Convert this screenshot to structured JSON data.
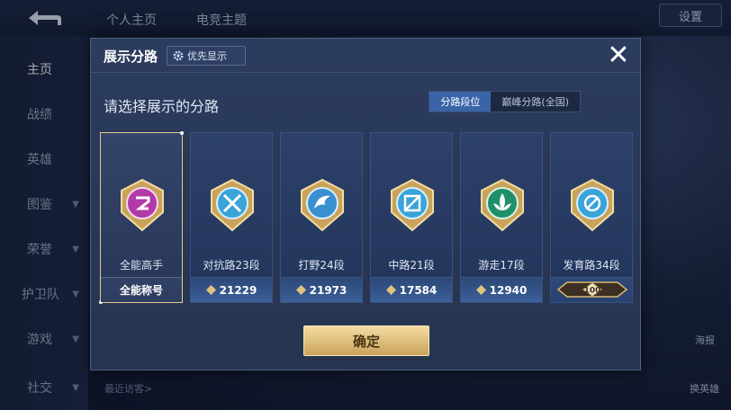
{
  "topbar": {
    "tabs": [
      "个人主页",
      "电竞主题"
    ],
    "settings_label": "设置"
  },
  "sidebar": {
    "items": [
      {
        "label": "主页",
        "active": true,
        "chevron": false
      },
      {
        "label": "战绩",
        "active": false,
        "chevron": false
      },
      {
        "label": "英雄",
        "active": false,
        "chevron": false
      },
      {
        "label": "图鉴",
        "active": false,
        "chevron": true
      },
      {
        "label": "荣誉",
        "active": false,
        "chevron": true
      },
      {
        "label": "护卫队",
        "active": false,
        "chevron": true
      },
      {
        "label": "游戏",
        "active": false,
        "chevron": true
      },
      {
        "label": "社交",
        "active": false,
        "chevron": true
      }
    ]
  },
  "bottom": {
    "recent_visitors": "最近访客>"
  },
  "right_panel": {
    "label_1": "海报",
    "label_2": "换英雄"
  },
  "dialog": {
    "title": "展示分路",
    "priority_label": "优先显示",
    "close_symbol": "✕",
    "prompt": "请选择展示的分路",
    "segments": [
      {
        "label": "分路段位",
        "active": true
      },
      {
        "label": "巅峰分路(全国)",
        "active": false
      }
    ],
    "cards": [
      {
        "label": "全能高手",
        "footer": "全能称号",
        "icon": "all-round-emblem",
        "color": "#b23aa8",
        "selected": true,
        "has_points": false
      },
      {
        "label": "对抗路23段",
        "footer": "21229",
        "icon": "clash-lane-emblem",
        "color": "#3aa3d8",
        "selected": false,
        "has_points": true
      },
      {
        "label": "打野24段",
        "footer": "21973",
        "icon": "jungle-emblem",
        "color": "#3a8fd0",
        "selected": false,
        "has_points": true
      },
      {
        "label": "中路21段",
        "footer": "17584",
        "icon": "mid-lane-emblem",
        "color": "#3aa3d8",
        "selected": false,
        "has_points": true
      },
      {
        "label": "游走17段",
        "footer": "12940",
        "icon": "roam-emblem",
        "color": "#1f8f6a",
        "selected": false,
        "has_points": true
      },
      {
        "label": "发育路34段",
        "footer": "100",
        "icon": "farm-lane-emblem",
        "color": "#3aa3d8",
        "selected": false,
        "has_points": false,
        "tier_banner": true
      }
    ],
    "confirm_label": "确定"
  }
}
